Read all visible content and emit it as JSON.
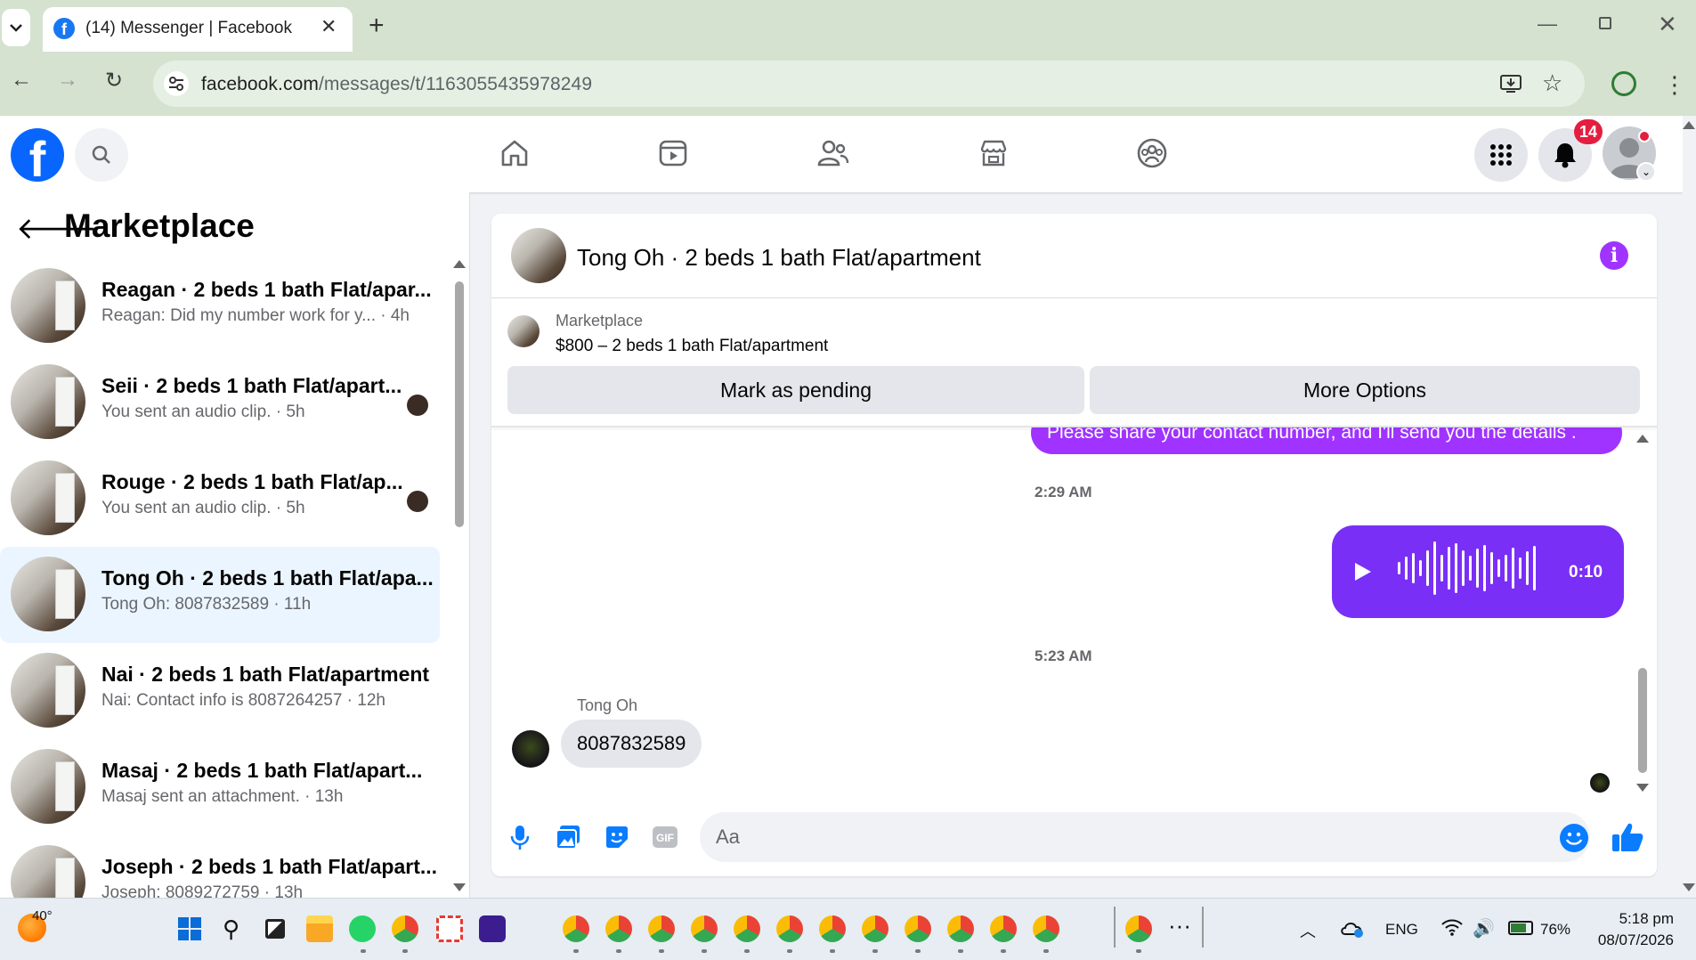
{
  "browser": {
    "tab_title": "(14) Messenger | Facebook",
    "url_host": "facebook.com",
    "url_path": "/messages/t/1163055435978249"
  },
  "facebook": {
    "notification_count": "14"
  },
  "left_panel": {
    "title": "Marketplace",
    "conversations": [
      {
        "name": "Reagan · 2 beds 1 bath Flat/apar...",
        "snippet": "Reagan: Did my number work for y... · 4h",
        "active": false,
        "seen": false
      },
      {
        "name": "Seii · 2 beds 1 bath Flat/apart...",
        "snippet": "You sent an audio clip. · 5h",
        "active": false,
        "seen": true
      },
      {
        "name": "Rouge · 2 beds 1 bath Flat/ap...",
        "snippet": "You sent an audio clip. · 5h",
        "active": false,
        "seen": true
      },
      {
        "name": "Tong Oh · 2 beds 1 bath Flat/apa...",
        "snippet": "Tong Oh: 8087832589 · 11h",
        "active": true,
        "seen": false
      },
      {
        "name": "Nai · 2 beds 1 bath Flat/apartment",
        "snippet": "Nai: Contact info is 8087264257 · 12h",
        "active": false,
        "seen": false
      },
      {
        "name": "Masaj · 2 beds 1 bath Flat/apart...",
        "snippet": "Masaj sent an attachment. · 13h",
        "active": false,
        "seen": false
      },
      {
        "name": "Joseph · 2 beds 1 bath Flat/apart...",
        "snippet": "Joseph: 8089272759 · 13h",
        "active": false,
        "seen": false
      }
    ]
  },
  "chat": {
    "title": "Tong Oh · 2 beds 1 bath Flat/apartment",
    "listing": {
      "source": "Marketplace",
      "title": "$800 – 2 beds 1 bath Flat/apartment",
      "mark_pending_label": "Mark as pending",
      "more_options_label": "More Options"
    },
    "messages": {
      "outgoing_text": "Please share your contact number, and I'll send you the details .",
      "timestamp_1": "2:29 AM",
      "audio_duration": "0:10",
      "timestamp_2": "5:23 AM",
      "incoming_sender": "Tong Oh",
      "incoming_text": "8087832589"
    },
    "composer": {
      "placeholder": "Aa"
    }
  },
  "taskbar": {
    "weather_temp": "40°",
    "language": "ENG",
    "battery_percent": "76%",
    "battery_level": 0.76,
    "time": "5:18 pm",
    "date": "08/07/2026"
  },
  "colors": {
    "facebook_blue": "#0866ff",
    "messenger_purple": "#a033ff",
    "audio_bubble": "#7a2ff7",
    "active_conv_bg": "#ebf5ff",
    "browser_chrome": "#d4e2cf"
  }
}
